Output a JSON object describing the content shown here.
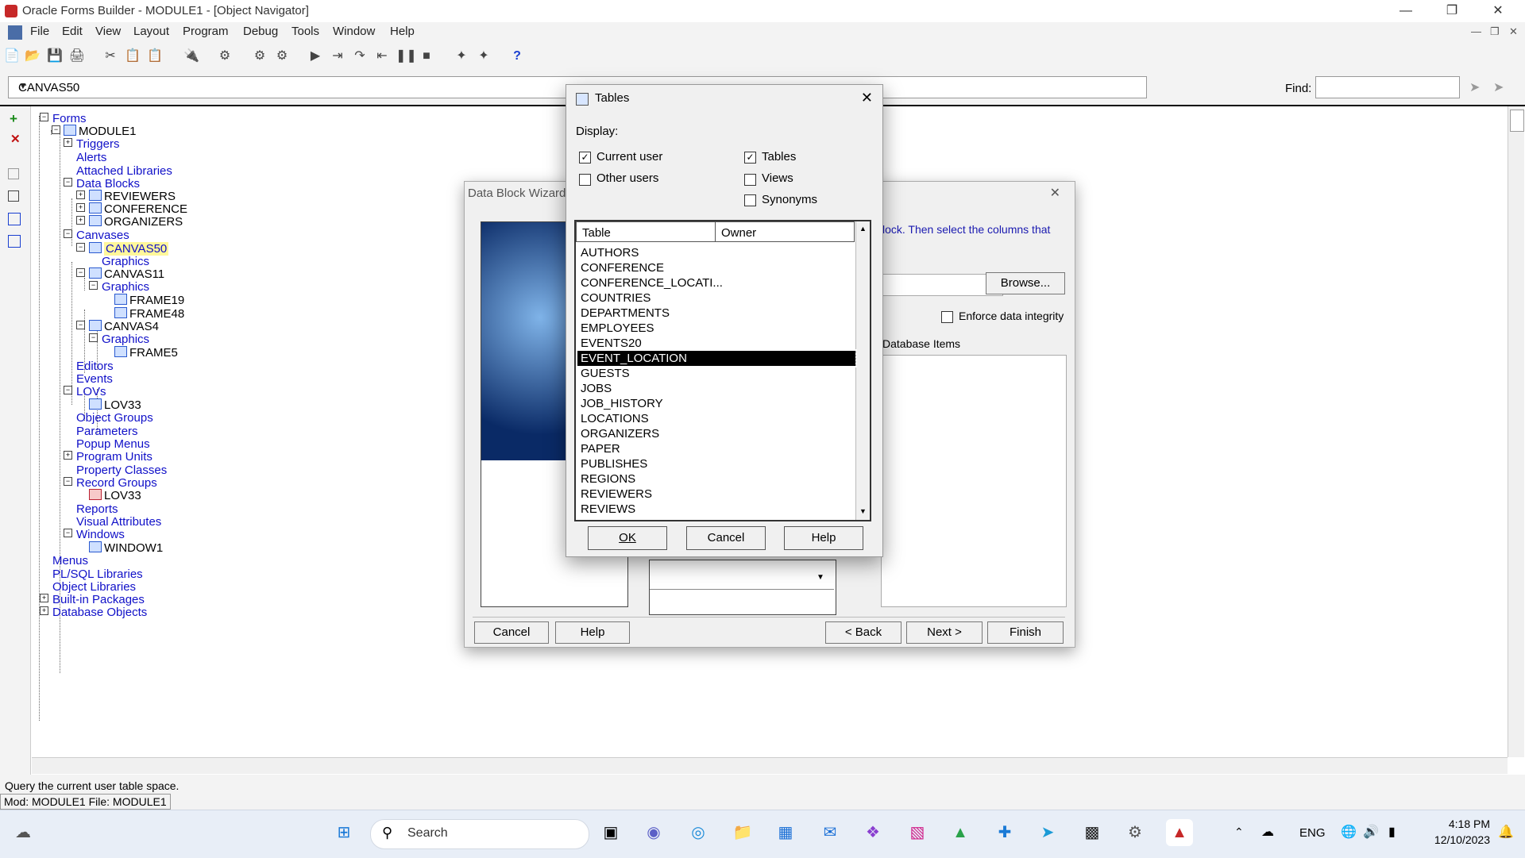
{
  "window": {
    "title": "Oracle Forms Builder - MODULE1 - [Object Navigator]"
  },
  "menu": [
    "File",
    "Edit",
    "View",
    "Layout",
    "Program",
    "Debug",
    "Tools",
    "Window",
    "Help"
  ],
  "navigator": {
    "combo_value": "CANVAS50",
    "find_label": "Find:",
    "tree": [
      {
        "label": "Forms",
        "level": 0
      },
      {
        "label": "MODULE1",
        "level": 1
      },
      {
        "label": "Triggers",
        "level": 2
      },
      {
        "label": "Alerts",
        "level": 2
      },
      {
        "label": "Attached Libraries",
        "level": 2
      },
      {
        "label": "Data Blocks",
        "level": 2
      },
      {
        "label": "REVIEWERS",
        "level": 3
      },
      {
        "label": "CONFERENCE",
        "level": 3
      },
      {
        "label": "ORGANIZERS",
        "level": 3
      },
      {
        "label": "Canvases",
        "level": 2
      },
      {
        "label": "CANVAS50",
        "level": 3
      },
      {
        "label": "Graphics",
        "level": 4
      },
      {
        "label": "CANVAS11",
        "level": 3
      },
      {
        "label": "Graphics",
        "level": 4
      },
      {
        "label": "FRAME19",
        "level": 5
      },
      {
        "label": "FRAME48",
        "level": 5
      },
      {
        "label": "CANVAS4",
        "level": 3
      },
      {
        "label": "Graphics",
        "level": 4
      },
      {
        "label": "FRAME5",
        "level": 5
      },
      {
        "label": "Editors",
        "level": 2
      },
      {
        "label": "Events",
        "level": 2
      },
      {
        "label": "LOVs",
        "level": 2
      },
      {
        "label": "LOV33",
        "level": 3
      },
      {
        "label": "Object Groups",
        "level": 2
      },
      {
        "label": "Parameters",
        "level": 2
      },
      {
        "label": "Popup Menus",
        "level": 2
      },
      {
        "label": "Program Units",
        "level": 2
      },
      {
        "label": "Property Classes",
        "level": 2
      },
      {
        "label": "Record Groups",
        "level": 2
      },
      {
        "label": "LOV33",
        "level": 3
      },
      {
        "label": "Reports",
        "level": 2
      },
      {
        "label": "Visual Attributes",
        "level": 2
      },
      {
        "label": "Windows",
        "level": 2
      },
      {
        "label": "WINDOW1",
        "level": 3
      },
      {
        "label": "Menus",
        "level": 0
      },
      {
        "label": "PL/SQL Libraries",
        "level": 0
      },
      {
        "label": "Object Libraries",
        "level": 0
      },
      {
        "label": "Built-in Packages",
        "level": 0
      },
      {
        "label": "Database Objects",
        "level": 0
      }
    ]
  },
  "status": {
    "line1": "Query the current user table space.",
    "line2": "Mod: MODULE1 File: MODULE1"
  },
  "wizard": {
    "title": "Data Block Wizard",
    "instruction_fragment": "lock.  Then select the columns that",
    "browse_label": "Browse...",
    "enforce_label": "Enforce data integrity",
    "db_items_label": "Database Items",
    "buttons": {
      "cancel": "Cancel",
      "help": "Help",
      "back": "< Back",
      "next": "Next >",
      "finish": "Finish"
    }
  },
  "tables_dialog": {
    "title": "Tables",
    "display_label": "Display:",
    "checkboxes": {
      "current_user": {
        "label": "Current user",
        "checked": true
      },
      "other_users": {
        "label": "Other users",
        "checked": false
      },
      "tables": {
        "label": "Tables",
        "checked": true
      },
      "views": {
        "label": "Views",
        "checked": false
      },
      "synonyms": {
        "label": "Synonyms",
        "checked": false
      }
    },
    "columns": [
      "Table",
      "Owner"
    ],
    "rows": [
      "AUTHORS",
      "CONFERENCE",
      "CONFERENCE_LOCATI...",
      "COUNTRIES",
      "DEPARTMENTS",
      "EMPLOYEES",
      "EVENTS20",
      "EVENT_LOCATION",
      "GUESTS",
      "JOBS",
      "JOB_HISTORY",
      "LOCATIONS",
      "ORGANIZERS",
      "PAPER",
      "PUBLISHES",
      "REGIONS",
      "REVIEWERS",
      "REVIEWS"
    ],
    "selected_row": "EVENT_LOCATION",
    "buttons": {
      "ok": "OK",
      "cancel": "Cancel",
      "help": "Help"
    }
  },
  "taskbar": {
    "search_placeholder": "Search",
    "lang": "ENG",
    "time": "4:18 PM",
    "date": "12/10/2023"
  }
}
